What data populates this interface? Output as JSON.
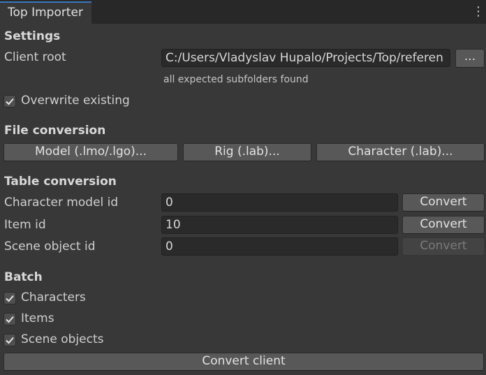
{
  "tab": {
    "title": "Top Importer"
  },
  "settings": {
    "title": "Settings",
    "client_root_label": "Client root",
    "client_root_value": "C:/Users/Vladyslav Hupalo/Projects/Top/referen",
    "browse_label": "...",
    "status_text": "all expected subfolders found",
    "overwrite_label": "Overwrite existing",
    "overwrite_checked": true
  },
  "file_conversion": {
    "title": "File conversion",
    "model_button": "Model (.lmo/.lgo)...",
    "rig_button": "Rig (.lab)...",
    "character_button": "Character (.lab)..."
  },
  "table_conversion": {
    "title": "Table conversion",
    "rows": [
      {
        "label": "Character model id",
        "value": "0",
        "button": "Convert",
        "enabled": true
      },
      {
        "label": "Item id",
        "value": "10",
        "button": "Convert",
        "enabled": true
      },
      {
        "label": "Scene object id",
        "value": "0",
        "button": "Convert",
        "enabled": false
      }
    ]
  },
  "batch": {
    "title": "Batch",
    "options": [
      {
        "label": "Characters",
        "checked": true
      },
      {
        "label": "Items",
        "checked": true
      },
      {
        "label": "Scene objects",
        "checked": true
      }
    ],
    "convert_client_button": "Convert client"
  },
  "colors": {
    "background": "#383838",
    "tabbar": "#282828",
    "field": "#2a2a2a",
    "button": "#585858",
    "accent": "#3a79bb"
  }
}
